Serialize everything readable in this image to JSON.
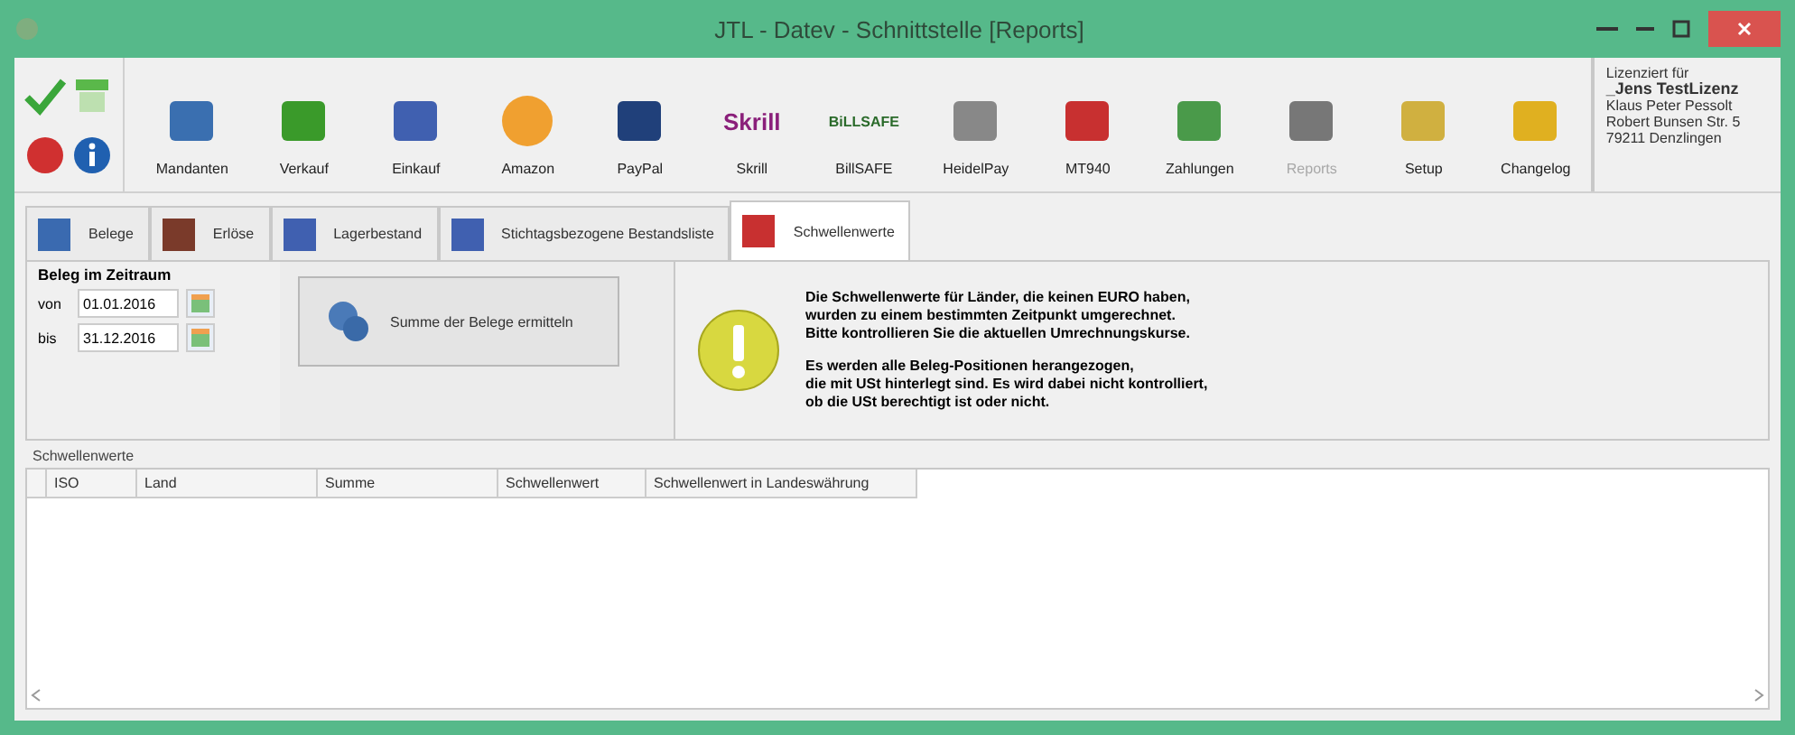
{
  "window": {
    "title": "JTL - Datev - Schnittstelle [Reports]"
  },
  "toolbar": {
    "tools": [
      {
        "label": "Mandanten",
        "disabled": false
      },
      {
        "label": "Verkauf",
        "disabled": false
      },
      {
        "label": "Einkauf",
        "disabled": false
      },
      {
        "label": "Amazon",
        "disabled": false
      },
      {
        "label": "PayPal",
        "disabled": false
      },
      {
        "label": "Skrill",
        "disabled": false,
        "logo": "Skrill"
      },
      {
        "label": "BillSAFE",
        "disabled": false,
        "logo": "BiLLSAFE"
      },
      {
        "label": "HeidelPay",
        "disabled": false
      },
      {
        "label": "MT940",
        "disabled": false
      },
      {
        "label": "Zahlungen",
        "disabled": false
      },
      {
        "label": "Reports",
        "disabled": true
      },
      {
        "label": "Setup",
        "disabled": false
      },
      {
        "label": "Changelog",
        "disabled": false
      }
    ]
  },
  "license": {
    "caption": "Lizenziert für",
    "name": "_Jens TestLizenz",
    "lines": [
      "Klaus Peter Pessolt",
      "Robert Bunsen Str. 5",
      "79211 Denzlingen"
    ]
  },
  "tabs": [
    {
      "label": "Belege",
      "selected": false
    },
    {
      "label": "Erlöse",
      "selected": false
    },
    {
      "label": "Lagerbestand",
      "selected": false
    },
    {
      "label": "Stichtagsbezogene Bestandsliste",
      "selected": false
    },
    {
      "label": "Schwellenwerte",
      "selected": true
    }
  ],
  "period": {
    "title": "Beleg im Zeitraum",
    "from_label": "von",
    "from": "01.01.2016",
    "to_label": "bis",
    "to": "31.12.2016"
  },
  "action_button": "Summe der Belege ermitteln",
  "notice": [
    "Die Schwellenwerte für Länder, die keinen EURO haben,",
    "wurden zu einem bestimmten Zeitpunkt umgerechnet.",
    "Bitte kontrollieren Sie die aktuellen Umrechnungskurse.",
    "Es werden alle Beleg-Positionen herangezogen,",
    "die mit USt hinterlegt sind. Es wird dabei nicht kontrolliert,",
    "ob die USt berechtigt ist oder nicht."
  ],
  "table": {
    "title": "Schwellenwerte",
    "columns": [
      "ISO",
      "Land",
      "Summe",
      "Schwellenwert",
      "Schwellenwert in Landeswährung"
    ]
  }
}
